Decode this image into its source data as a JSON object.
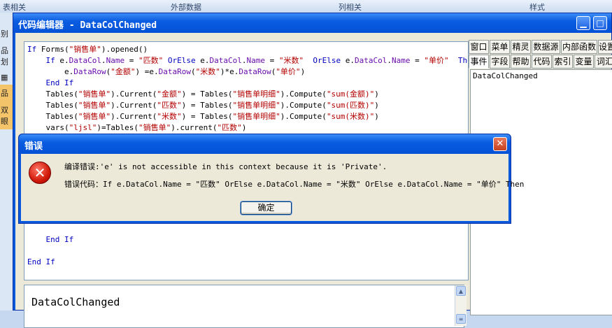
{
  "background": {
    "top_labels": [
      "表相关",
      "外部数据",
      "列相关",
      "样式"
    ],
    "left_labels": [
      "别",
      "品划",
      "",
      "品",
      "双眼"
    ]
  },
  "editor": {
    "title": "代码编辑器 - DataColChanged",
    "code_lines": [
      "If Forms(\"销售单\").opened()",
      "    If e.DataCol.Name = \"匹数\" OrElse e.DataCol.Name = \"米数\"  OrElse e.DataCol.Name = \"单价\"  Then",
      "        e.DataRow(\"金额\") =e.DataRow(\"米数\")*e.DataRow(\"单价\")",
      "    End If",
      "    Tables(\"销售单\").Current(\"金额\") = Tables(\"销售单明细\").Compute(\"sum(金额)\")",
      "    Tables(\"销售单\").Current(\"匹数\") = Tables(\"销售单明细\").Compute(\"sum(匹数)\")",
      "    Tables(\"销售单\").Current(\"米数\") = Tables(\"销售单明细\").Compute(\"sum(米数)\")",
      "    vars(\"ljsl\")=Tables(\"销售单\").current(\"匹数\")",
      "",
      "",
      "",
      "",
      "",
      "",
      "",
      "",
      "",
      "    End If",
      "",
      "End If"
    ],
    "output_text": "DataColChanged",
    "tabs_row1": [
      "窗口",
      "菜单",
      "精灵",
      "数据源",
      "内部函数",
      "设置"
    ],
    "tabs_row2": [
      "事件",
      "字段",
      "帮助",
      "代码",
      "索引",
      "变量",
      "词汇"
    ],
    "panel_items": [
      "DataColChanged"
    ]
  },
  "error_dialog": {
    "title": "错误",
    "line1": "编译错误:'e' is not accessible in this context because it is 'Private'.",
    "line2": "错误代码：If e.DataCol.Name = \"匹数\" OrElse e.DataCol.Name = \"米数\"  OrElse e.DataCol.Name = \"单价\"  Then",
    "ok_label": "确定",
    "close_glyph": "✕",
    "icon_glyph": "✕"
  }
}
